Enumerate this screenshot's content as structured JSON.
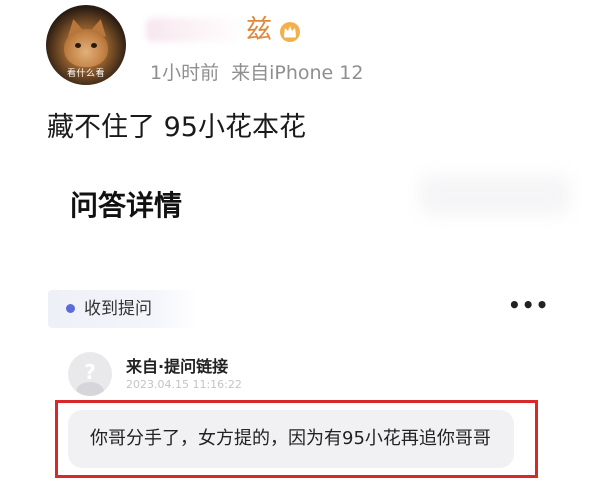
{
  "post": {
    "author_name_visible": "兹",
    "time_ago": "1小时前",
    "source": "来自iPhone 12",
    "avatar_caption": "看什么看",
    "text": "藏不住了 95小花本花"
  },
  "qa": {
    "title": "问答详情",
    "received_label": "收到提问",
    "more_label": "•••",
    "question": {
      "from": "来自·提问链接",
      "timestamp": "2023.04.15 11:16:22",
      "text": "你哥分手了，女方提的，因为有95小花再追你哥哥"
    }
  },
  "colors": {
    "accent_dot": "#5d6bd6",
    "highlight_border": "#d92828",
    "name_color": "#e0873a",
    "meta_gray": "#8f8f8f"
  },
  "icons": {
    "badge": "crown-badge-icon",
    "avatar": "cat-avatar",
    "question_avatar": "anonymous-avatar-icon"
  }
}
